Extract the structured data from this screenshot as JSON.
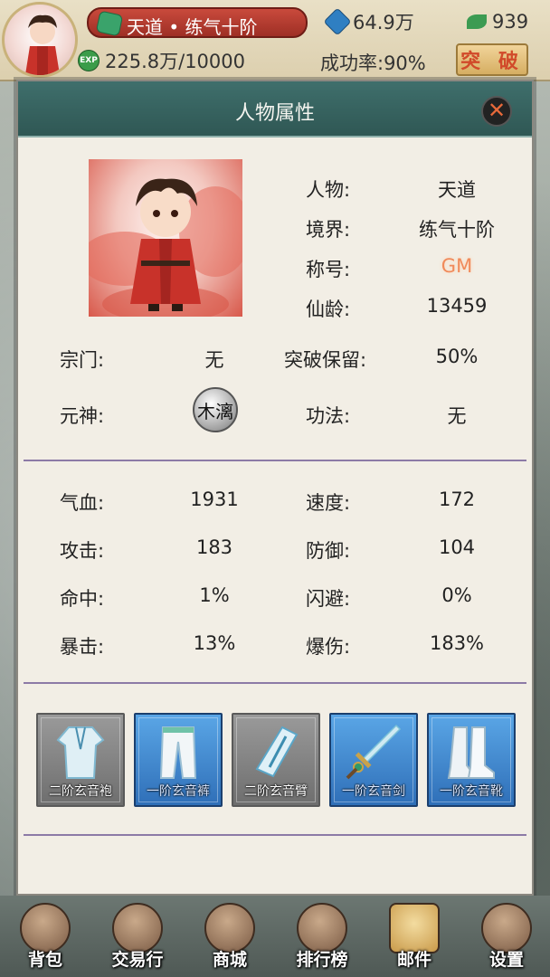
{
  "player": {
    "name_realm": "天道 • 练气十阶",
    "spirit_stones": "64.9万",
    "leaves": "939",
    "exp": "225.8万/10000",
    "success_rate": "成功率:90%",
    "breakthrough_label": "突 破"
  },
  "modal": {
    "title": "人物属性",
    "close_label": "✕"
  },
  "info": {
    "character_label": "人物:",
    "character_value": "天道",
    "realm_label": "境界:",
    "realm_value": "练气十阶",
    "title_label": "称号:",
    "title_value": "GM",
    "age_label": "仙龄:",
    "age_value": "13459",
    "sect_label": "宗门:",
    "sect_value": "无",
    "retain_label": "突破保留:",
    "retain_value": "50%",
    "soul_label": "元神:",
    "soul_value": "木漓",
    "technique_label": "功法:",
    "technique_value": "无"
  },
  "stats": {
    "hp_label": "气血:",
    "hp_value": "1931",
    "speed_label": "速度:",
    "speed_value": "172",
    "attack_label": "攻击:",
    "attack_value": "183",
    "defense_label": "防御:",
    "defense_value": "104",
    "hit_label": "命中:",
    "hit_value": "1%",
    "dodge_label": "闪避:",
    "dodge_value": "0%",
    "crit_label": "暴击:",
    "crit_value": "13%",
    "critdmg_label": "爆伤:",
    "critdmg_value": "183%"
  },
  "equipment": [
    {
      "name": "二阶玄音袍",
      "tier": "grey",
      "icon": "robe-icon"
    },
    {
      "name": "一阶玄音裤",
      "tier": "blue",
      "icon": "pants-icon"
    },
    {
      "name": "二阶玄音臂",
      "tier": "grey",
      "icon": "bracer-icon"
    },
    {
      "name": "一阶玄音剑",
      "tier": "blue",
      "icon": "sword-icon"
    },
    {
      "name": "一阶玄音靴",
      "tier": "blue",
      "icon": "boots-icon"
    }
  ],
  "nav": [
    {
      "label": "背包",
      "icon": "bag-icon"
    },
    {
      "label": "交易行",
      "icon": "abacus-icon"
    },
    {
      "label": "商城",
      "icon": "shop-icon"
    },
    {
      "label": "排行榜",
      "icon": "ranking-icon"
    },
    {
      "label": "邮件",
      "icon": "mail-icon"
    },
    {
      "label": "设置",
      "icon": "gear-icon"
    }
  ],
  "colors": {
    "header": "#2f5754",
    "panel": "#f2eee5",
    "divider": "#8c7aa6",
    "gm": "#f08a5a",
    "grey_tier": "#6e6e6e",
    "blue_tier": "#2f6fb8"
  }
}
